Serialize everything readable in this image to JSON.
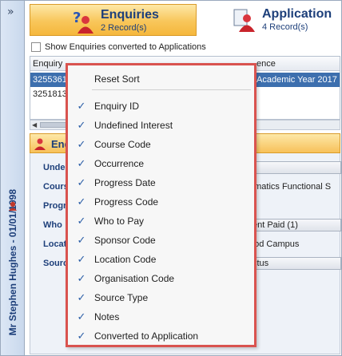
{
  "side": {
    "collapse_glyph": "»",
    "record_name": "Mr Stephen Hughes - 01/01/1998"
  },
  "tiles": {
    "enquiries": {
      "title": "Enquiries",
      "count": "2 Record(s)",
      "icon": "question-person-icon"
    },
    "application": {
      "title": "Application",
      "count": "4 Record(s)",
      "icon": "person-icon"
    }
  },
  "show_converted": {
    "label": "Show Enquiries converted to Applications",
    "checked": false
  },
  "grid": {
    "headers": [
      "Enquiry",
      "ence"
    ],
    "rows": [
      [
        "3255361",
        "Academic Year 2017"
      ],
      [
        "3251813",
        ""
      ]
    ]
  },
  "panel": {
    "title": "Enq",
    "labels": [
      "Unde",
      "Cours",
      "Progr",
      "Who",
      "Locat",
      "Sourc"
    ],
    "values": [
      "",
      "ematics Functional S",
      "",
      "ent Paid (1)",
      "ood Campus",
      "ctus"
    ]
  },
  "context_menu": {
    "reset_label": "Reset Sort",
    "items": [
      {
        "label": "Enquiry ID",
        "checked": true
      },
      {
        "label": "Undefined Interest",
        "checked": true
      },
      {
        "label": "Course Code",
        "checked": true
      },
      {
        "label": "Occurrence",
        "checked": true
      },
      {
        "label": "Progress Date",
        "checked": true
      },
      {
        "label": "Progress Code",
        "checked": true
      },
      {
        "label": "Who to Pay",
        "checked": true
      },
      {
        "label": "Sponsor Code",
        "checked": true
      },
      {
        "label": "Location Code",
        "checked": true
      },
      {
        "label": "Organisation Code",
        "checked": true
      },
      {
        "label": "Source Type",
        "checked": true
      },
      {
        "label": "Notes",
        "checked": true
      },
      {
        "label": "Converted to Application",
        "checked": true
      }
    ],
    "check_glyph": "✓"
  },
  "colors": {
    "accent": "#1d3f7a",
    "highlight": "#d9534f",
    "tile": "#f8c65a"
  }
}
